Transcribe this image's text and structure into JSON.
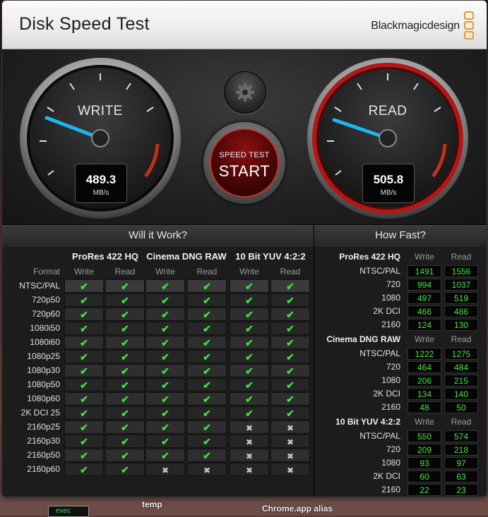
{
  "window": {
    "title": "Disk Speed Test",
    "brand": "Blackmagicdesign",
    "brand_color": "#e89a23"
  },
  "gauges": {
    "write": {
      "label": "WRITE",
      "value": "489.3",
      "unit": "MB/s",
      "needle_color": "#19b7f2"
    },
    "read": {
      "label": "READ",
      "value": "505.8",
      "unit": "MB/s",
      "needle_color": "#19b7f2",
      "ring_color": "#a01818"
    }
  },
  "controls": {
    "settings_icon": "gear-icon",
    "start_top": "SPEED TEST",
    "start_main": "START"
  },
  "will_it_work": {
    "title": "Will it Work?",
    "format_label": "Format",
    "groups": [
      "ProRes 422 HQ",
      "Cinema DNG RAW",
      "10 Bit YUV 4:2:2"
    ],
    "sub": [
      "Write",
      "Read"
    ],
    "rows": [
      {
        "format": "NTSC/PAL",
        "results": [
          1,
          1,
          1,
          1,
          1,
          1
        ]
      },
      {
        "format": "720p50",
        "results": [
          1,
          1,
          1,
          1,
          1,
          1
        ]
      },
      {
        "format": "720p60",
        "results": [
          1,
          1,
          1,
          1,
          1,
          1
        ]
      },
      {
        "format": "1080i50",
        "results": [
          1,
          1,
          1,
          1,
          1,
          1
        ]
      },
      {
        "format": "1080i60",
        "results": [
          1,
          1,
          1,
          1,
          1,
          1
        ]
      },
      {
        "format": "1080p25",
        "results": [
          1,
          1,
          1,
          1,
          1,
          1
        ]
      },
      {
        "format": "1080p30",
        "results": [
          1,
          1,
          1,
          1,
          1,
          1
        ]
      },
      {
        "format": "1080p50",
        "results": [
          1,
          1,
          1,
          1,
          1,
          1
        ]
      },
      {
        "format": "1080p60",
        "results": [
          1,
          1,
          1,
          1,
          1,
          1
        ]
      },
      {
        "format": "2K DCI 25",
        "results": [
          1,
          1,
          1,
          1,
          1,
          1
        ]
      },
      {
        "format": "2160p25",
        "results": [
          1,
          1,
          1,
          1,
          0,
          0
        ]
      },
      {
        "format": "2160p30",
        "results": [
          1,
          1,
          1,
          1,
          0,
          0
        ]
      },
      {
        "format": "2160p50",
        "results": [
          1,
          1,
          1,
          1,
          0,
          0
        ]
      },
      {
        "format": "2160p60",
        "results": [
          1,
          1,
          0,
          0,
          0,
          0
        ]
      }
    ],
    "check_glyph": "✔",
    "cross_glyph": "✖",
    "check_color": "#40e040"
  },
  "how_fast": {
    "title": "How Fast?",
    "sub": [
      "Write",
      "Read"
    ],
    "groups": [
      {
        "name": "ProRes 422 HQ",
        "rows": [
          {
            "label": "NTSC/PAL",
            "write": "1491",
            "read": "1556"
          },
          {
            "label": "720",
            "write": "994",
            "read": "1037"
          },
          {
            "label": "1080",
            "write": "497",
            "read": "519"
          },
          {
            "label": "2K DCI",
            "write": "466",
            "read": "486"
          },
          {
            "label": "2160",
            "write": "124",
            "read": "130"
          }
        ]
      },
      {
        "name": "Cinema DNG RAW",
        "rows": [
          {
            "label": "NTSC/PAL",
            "write": "1222",
            "read": "1275"
          },
          {
            "label": "720",
            "write": "464",
            "read": "484"
          },
          {
            "label": "1080",
            "write": "206",
            "read": "215"
          },
          {
            "label": "2K DCI",
            "write": "134",
            "read": "140"
          },
          {
            "label": "2160",
            "write": "48",
            "read": "50"
          }
        ]
      },
      {
        "name": "10 Bit YUV 4:2:2",
        "rows": [
          {
            "label": "NTSC/PAL",
            "write": "550",
            "read": "574"
          },
          {
            "label": "720",
            "write": "209",
            "read": "218"
          },
          {
            "label": "1080",
            "write": "93",
            "read": "97"
          },
          {
            "label": "2K DCI",
            "write": "60",
            "read": "63"
          },
          {
            "label": "2160",
            "write": "22",
            "read": "23"
          }
        ]
      }
    ]
  },
  "desktop": {
    "temp_label": "temp",
    "alias_label": "Chrome.app alias",
    "exec_label": "exec"
  }
}
